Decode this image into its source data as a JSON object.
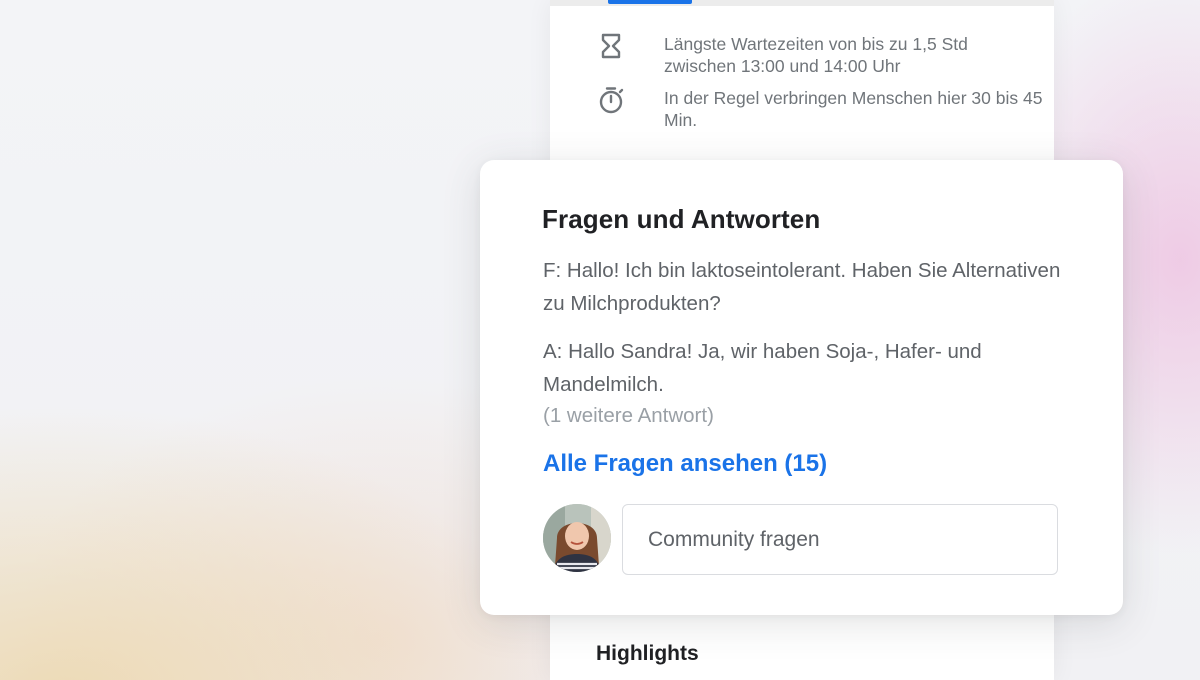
{
  "panel": {
    "wait_longest": "Längste Wartezeiten von bis zu 1,5 Std zwischen 13:00 und 14:00 Uhr",
    "wait_typical": "In der Regel verbringen Menschen hier 30 bis 45 Min.",
    "highlights_title": "Highlights",
    "wait_icon": "hourglass-icon",
    "time_icon": "stopwatch-icon",
    "tab_indicator_color": "#1a73e8"
  },
  "qa_card": {
    "title": "Fragen und Antworten",
    "question": "F: Hallo! Ich bin laktoseintolerant. Haben Sie Alternativen zu Milchprodukten?",
    "answer": "A: Hallo Sandra! Ja, wir haben Soja-, Hafer- und Mandelmilch.",
    "more_answers": "(1 weitere Antwort)",
    "see_all_link": "Alle Fragen ansehen (15)",
    "ask_placeholder": "Community fragen",
    "link_color": "#1a73e8"
  }
}
